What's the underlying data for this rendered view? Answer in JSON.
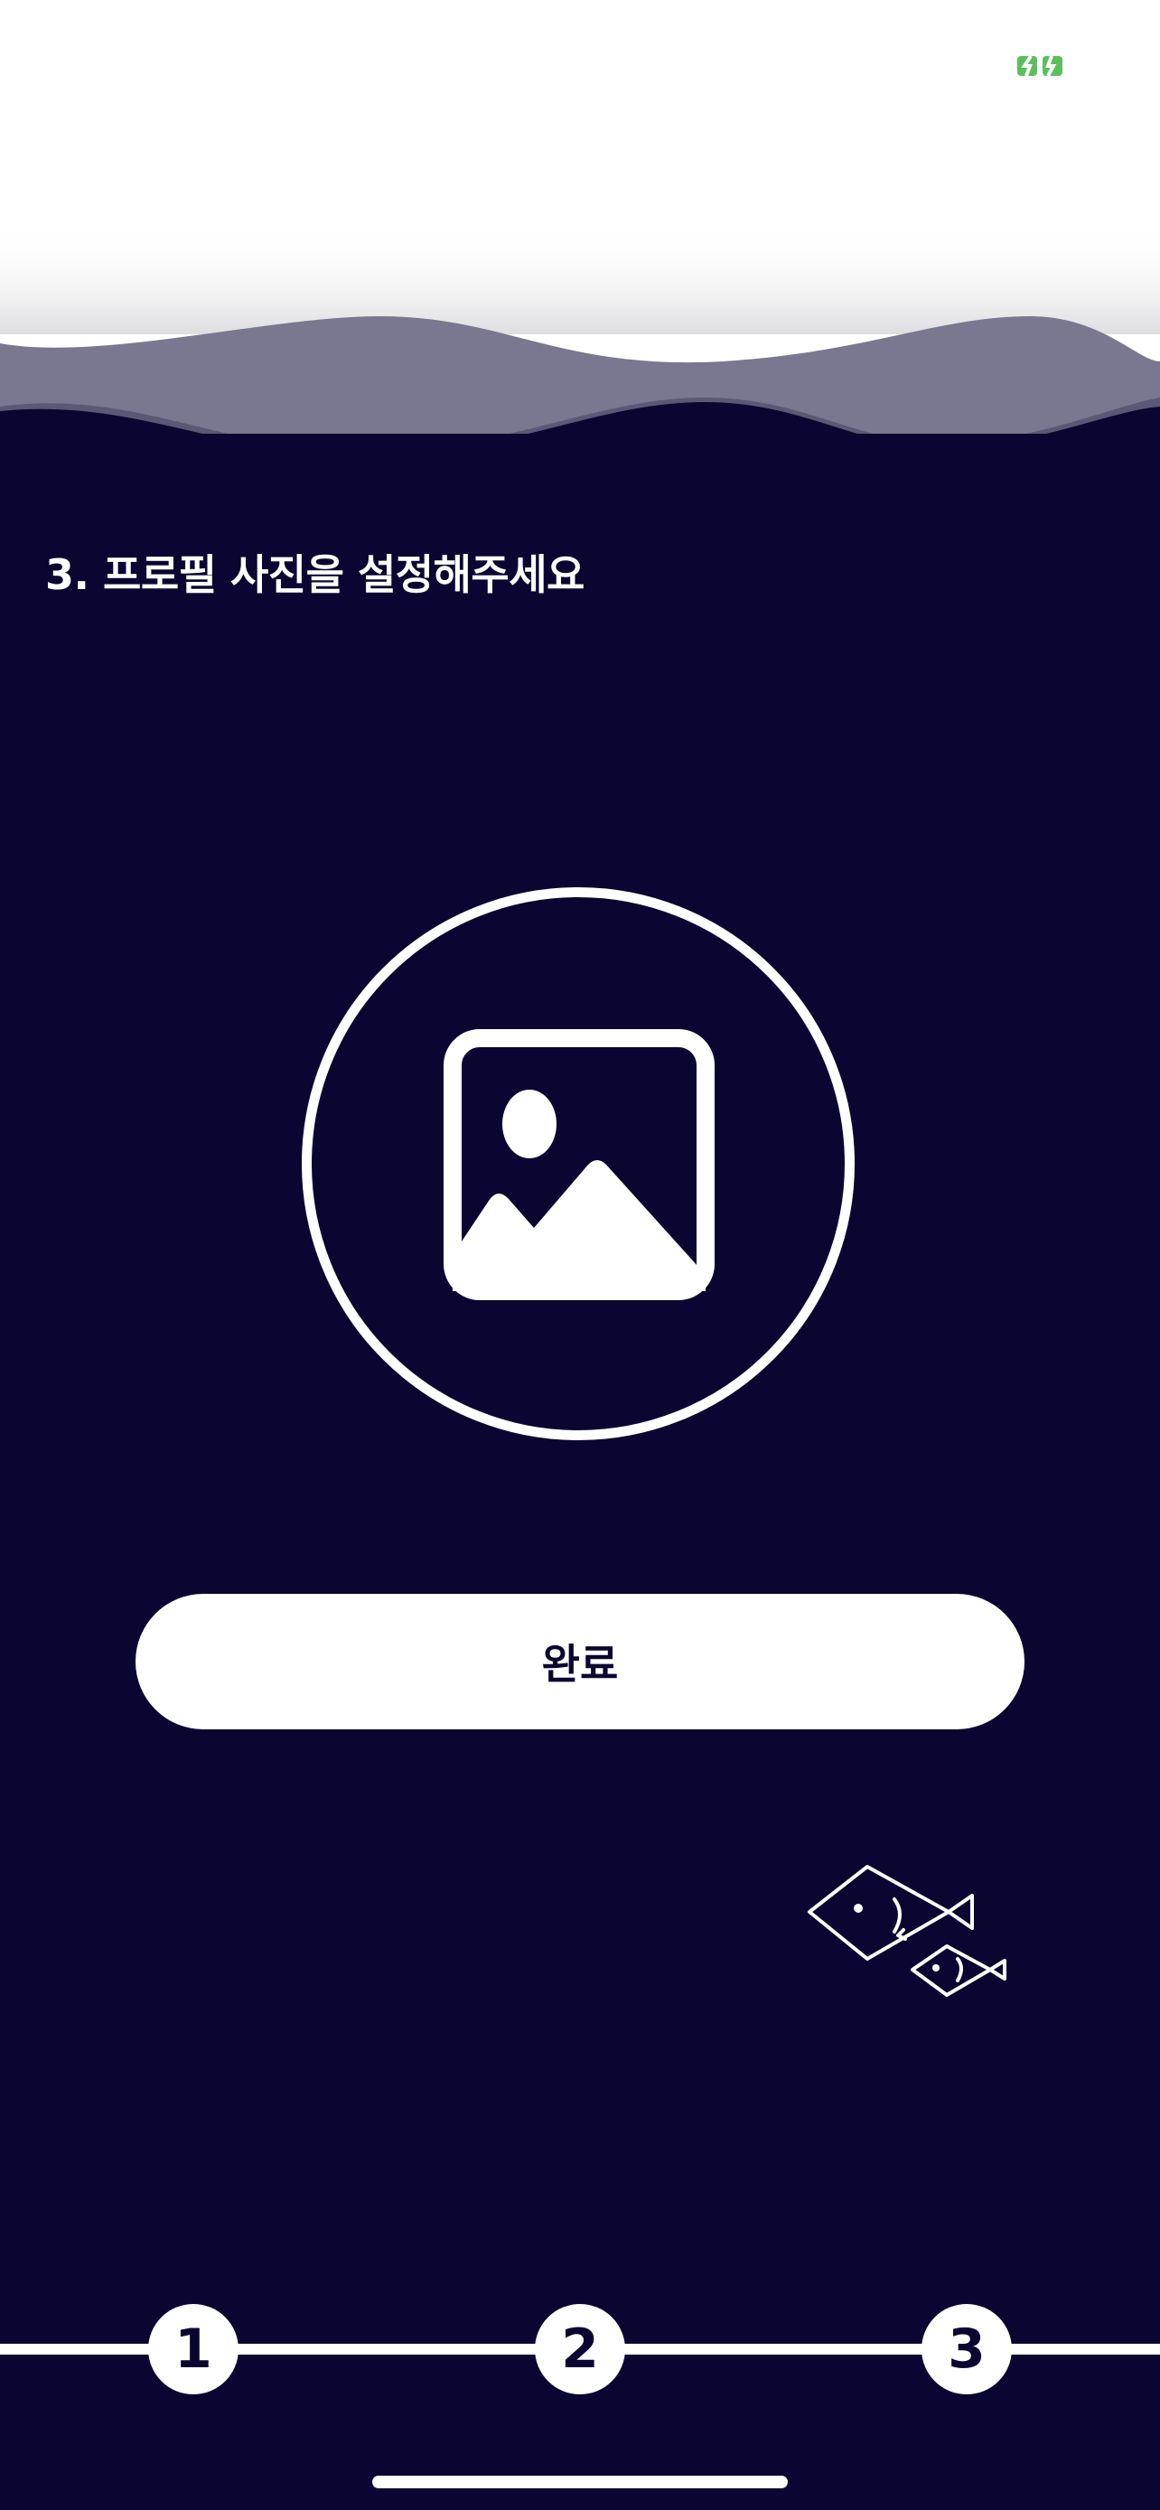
{
  "colors": {
    "ocean": "#0a0631",
    "wave_back": "#7a7790",
    "wave_front": "#5a5874",
    "status_indicator": "#5cbf5c"
  },
  "icons": {
    "status": "battery-charging-icon",
    "photo": "image-placeholder-icon",
    "fish": "fish-pair-icon"
  },
  "onboarding": {
    "title": "3. 프로필 사진을 설정해주세요",
    "complete_label": "완료"
  },
  "stepper": {
    "current_step": 3,
    "steps": [
      "1",
      "2",
      "3"
    ]
  }
}
